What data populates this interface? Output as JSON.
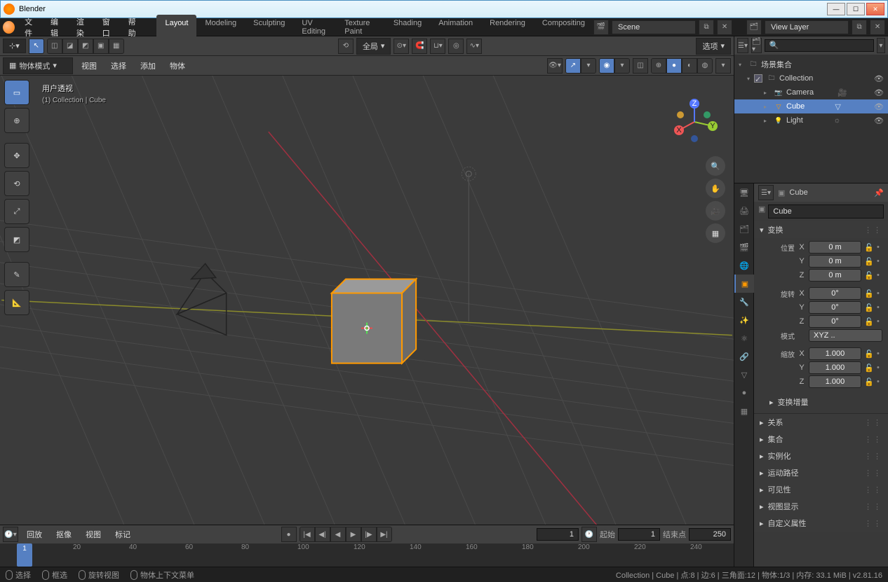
{
  "window": {
    "title": "Blender"
  },
  "menu": {
    "file": "文件",
    "edit": "编辑",
    "render": "渲染",
    "window": "窗口",
    "help": "帮助"
  },
  "tabs": [
    "Layout",
    "Modeling",
    "Sculpting",
    "UV Editing",
    "Texture Paint",
    "Shading",
    "Animation",
    "Rendering",
    "Compositing"
  ],
  "active_tab": "Layout",
  "scene": {
    "label": "Scene",
    "layer": "View Layer"
  },
  "v3d": {
    "orientation": "全局",
    "mode": "物体模式",
    "menus": {
      "view": "视图",
      "select": "选择",
      "add": "添加",
      "object": "物体"
    },
    "options": "选项",
    "overlay": {
      "title": "用户透视",
      "sub": "(1) Collection | Cube"
    },
    "tools": [
      "select-box",
      "cursor",
      "move",
      "rotate",
      "scale",
      "transform",
      "annotate",
      "measure"
    ]
  },
  "timeline": {
    "menus": {
      "playback": "回放",
      "keying": "抠像",
      "view": "视图",
      "marker": "标记"
    },
    "current": 1,
    "start_label": "起始",
    "start": 1,
    "end_label": "结束点",
    "end": 250,
    "ticks": [
      20,
      40,
      60,
      80,
      100,
      120,
      140,
      160,
      180,
      200,
      220,
      240
    ]
  },
  "status": {
    "select": "选择",
    "box": "框选",
    "rotate": "旋转视图",
    "context": "物体上下文菜单",
    "info": "Collection | Cube | 点:8 | 边:6 | 三角面:12 | 物体:1/3 | 内存: 33.1 MiB | v2.81.16"
  },
  "outliner": {
    "root": "场景集合",
    "collection": "Collection",
    "items": [
      {
        "name": "Camera",
        "icon": "📷",
        "color": "#f90"
      },
      {
        "name": "Cube",
        "icon": "▽",
        "color": "#f90",
        "selected": true
      },
      {
        "name": "Light",
        "icon": "💡",
        "color": "#f90"
      }
    ]
  },
  "props": {
    "breadcrumb": "Cube",
    "object_name": "Cube",
    "panels": {
      "transform": {
        "title": "变换",
        "location": {
          "label": "位置",
          "x": "0 m",
          "y": "0 m",
          "z": "0 m"
        },
        "rotation": {
          "label": "旋转",
          "x": "0°",
          "y": "0°",
          "z": "0°"
        },
        "mode": {
          "label": "模式",
          "value": "XYZ .."
        },
        "scale": {
          "label": "缩放",
          "x": "1.000",
          "y": "1.000",
          "z": "1.000"
        },
        "delta": "变换增量"
      },
      "collapsed": [
        "关系",
        "集合",
        "实例化",
        "运动路径",
        "可见性",
        "视图显示",
        "自定义属性"
      ]
    }
  }
}
